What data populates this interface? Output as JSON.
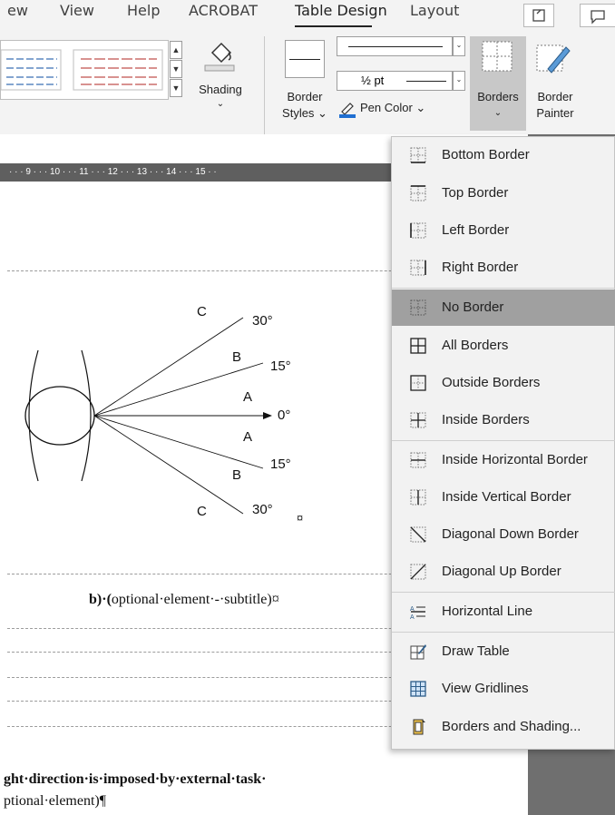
{
  "ribbon": {
    "tabs": [
      "ew",
      "View",
      "Help",
      "ACROBAT",
      "Table Design",
      "Layout"
    ],
    "active_tab": "Table Design",
    "shading_label": "Shading",
    "border_styles_label_1": "Border",
    "border_styles_label_2": "Styles",
    "pen_weight": "½ pt",
    "pen_color_label": "Pen Color",
    "borders_label": "Borders",
    "border_painter_label_1": "Border",
    "border_painter_label_2": "Painter",
    "pen_color_accent": "#1f6fd1"
  },
  "ruler": {
    "text": "· · · 9 · · · 10 · · · 11 · · · 12 · · · 13 · · · 14 · · · 15 · ·"
  },
  "diagram": {
    "labels": {
      "c_top": "C",
      "deg30_top": "30°",
      "b_top": "B",
      "deg15_top": "15°",
      "a_top": "A",
      "deg0": "0°",
      "a_bottom": "A",
      "deg15_bottom": "15°",
      "b_bottom": "B",
      "c_bottom": "C",
      "deg30_bottom": "30°"
    },
    "cell_marker": "¤"
  },
  "document": {
    "subtitle_bold": "b)·(",
    "subtitle_rest": "optional·element·-·subtitle)¤",
    "body_line_1": "ght·direction·is·imposed·by·external·task·",
    "body_line_2": "ptional·element)¶"
  },
  "menu": {
    "items": [
      {
        "label": "Bottom Border",
        "icon": "bottom-border-icon"
      },
      {
        "label": "Top Border",
        "icon": "top-border-icon"
      },
      {
        "label": "Left Border",
        "icon": "left-border-icon"
      },
      {
        "label": "Right Border",
        "icon": "right-border-icon"
      },
      {
        "label": "No Border",
        "icon": "no-border-icon"
      },
      {
        "label": "All Borders",
        "icon": "all-borders-icon"
      },
      {
        "label": "Outside Borders",
        "icon": "outside-borders-icon"
      },
      {
        "label": "Inside Borders",
        "icon": "inside-borders-icon"
      },
      {
        "label": "Inside Horizontal Border",
        "icon": "inside-horizontal-border-icon"
      },
      {
        "label": "Inside Vertical Border",
        "icon": "inside-vertical-border-icon"
      },
      {
        "label": "Diagonal Down Border",
        "icon": "diagonal-down-border-icon"
      },
      {
        "label": "Diagonal Up Border",
        "icon": "diagonal-up-border-icon"
      },
      {
        "label": "Horizontal Line",
        "icon": "horizontal-line-icon"
      },
      {
        "label": "Draw Table",
        "icon": "draw-table-icon"
      },
      {
        "label": "View Gridlines",
        "icon": "view-gridlines-icon"
      },
      {
        "label": "Borders and Shading...",
        "icon": "borders-and-shading-icon"
      }
    ],
    "hovered": "No Border"
  }
}
